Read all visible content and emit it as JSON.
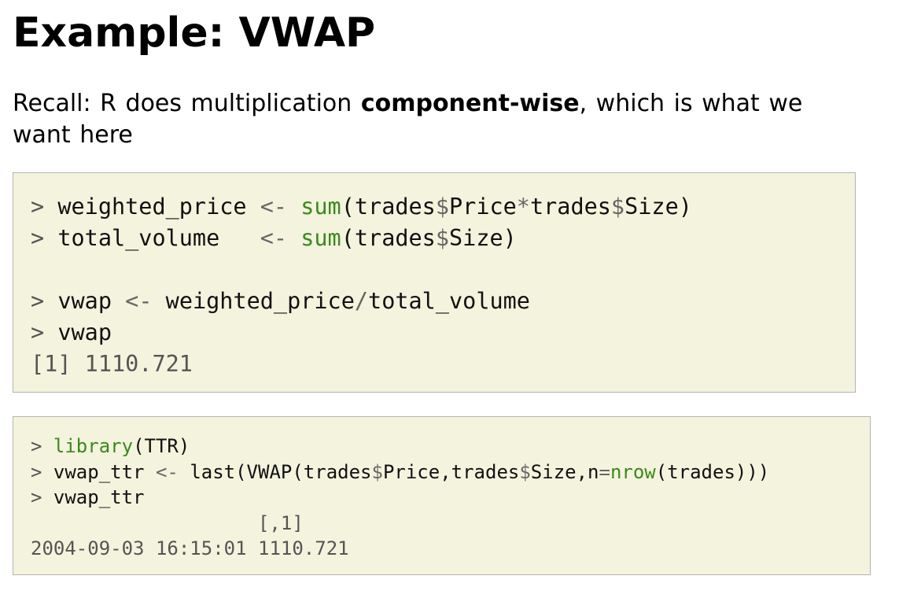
{
  "slide": {
    "title": "Example: VWAP",
    "intro": {
      "prefix": "Recall: R does multiplication ",
      "bold": "component-wise",
      "suffix": ", which is what we want here"
    }
  },
  "code_block_1": {
    "line1": {
      "prompt": ">",
      "lhs": "weighted_price",
      "assign": "<-",
      "fn": "sum",
      "open": "(trades",
      "dollar1": "$",
      "field1": "Price",
      "mul": "*",
      "mid": "trades",
      "dollar2": "$",
      "field2": "Size)"
    },
    "line2": {
      "prompt": ">",
      "lhs": "total_volume",
      "assign": "<-",
      "fn": "sum",
      "open": "(trades",
      "dollar": "$",
      "field": "Size)"
    },
    "line3": {
      "prompt": ">",
      "lhs": "vwap",
      "assign": "<-",
      "a": "weighted_price",
      "div": "/",
      "b": "total_volume"
    },
    "line4": {
      "prompt": ">",
      "expr": "vwap"
    },
    "output": {
      "index": "[1]",
      "value": "1110.721"
    }
  },
  "code_block_2": {
    "line1": {
      "prompt": ">",
      "fn": "library",
      "args": "(TTR)"
    },
    "line2": {
      "prompt": ">",
      "lhs": "vwap_ttr",
      "assign": "<-",
      "call": "last(VWAP(trades",
      "dollar1": "$",
      "field1": "Price,trades",
      "dollar2": "$",
      "field2": "Size,n",
      "eq": "=",
      "fn2": "nrow",
      "tail": "(trades)))"
    },
    "line3": {
      "prompt": ">",
      "expr": "vwap_ttr"
    },
    "out_header": {
      "open": "[,",
      "col": "1",
      "close": "]"
    },
    "out_row": {
      "date": "2004-09-03",
      "time": "16:15:01",
      "value": "1110.721"
    }
  }
}
